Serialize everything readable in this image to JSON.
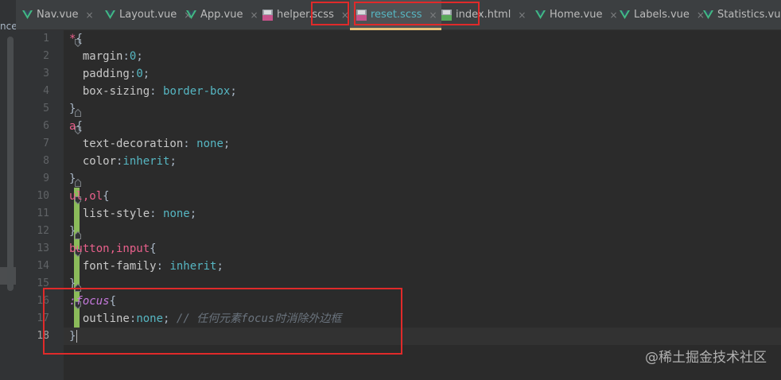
{
  "left_panel": {
    "fragment": "nce"
  },
  "tabs": [
    {
      "name": "nav-vue",
      "label": "Nav.vue",
      "icon": "vue-icon",
      "active": false
    },
    {
      "name": "layout-vue",
      "label": "Layout.vue",
      "icon": "vue-icon",
      "active": false
    },
    {
      "name": "app-vue",
      "label": "App.vue",
      "icon": "vue-icon",
      "active": false
    },
    {
      "name": "helper-scss",
      "label": "helper.scss",
      "icon": "sass-icon",
      "active": false
    },
    {
      "name": "reset-scss",
      "label": "reset.scss",
      "icon": "sass-icon",
      "active": true
    },
    {
      "name": "index-html",
      "label": "index.html",
      "icon": "html-icon",
      "active": false
    },
    {
      "name": "home-vue",
      "label": "Home.vue",
      "icon": "vue-icon",
      "active": false
    },
    {
      "name": "labels-vue",
      "label": "Labels.vue",
      "icon": "vue-icon",
      "active": false
    },
    {
      "name": "statistics-vue",
      "label": "Statistics.vue",
      "icon": "vue-icon",
      "active": false
    }
  ],
  "tab_close_glyph": "×",
  "colors": {
    "selector": "#e8608b",
    "value": "#6897bb",
    "keyword": "#56b6c2",
    "comment": "#6a737d",
    "pseudo": "#c679dd",
    "change_bar": "#8bbb5a",
    "highlight_box": "#e02a2a",
    "active_tab_underline": "#e5c07b"
  },
  "editor": {
    "current_line": 18,
    "lines": [
      {
        "n": "1",
        "selector": "*",
        "open": "{"
      },
      {
        "n": "2",
        "prop": "margin",
        "sep": ":",
        "value": "0",
        "end": ";"
      },
      {
        "n": "3",
        "prop": "padding",
        "sep": ":",
        "value": "0",
        "end": ";"
      },
      {
        "n": "4",
        "prop": "box-sizing",
        "sep": ": ",
        "value": "border-box",
        "end": ";"
      },
      {
        "n": "5",
        "close": "}"
      },
      {
        "n": "6",
        "selector": "a",
        "open": "{"
      },
      {
        "n": "7",
        "prop": "text-decoration",
        "sep": ": ",
        "value": "none",
        "end": ";"
      },
      {
        "n": "8",
        "prop": "color",
        "sep": ":",
        "value": "inherit",
        "end": ";"
      },
      {
        "n": "9",
        "close": "}"
      },
      {
        "n": "10",
        "selector": "ul,ol",
        "open": "{"
      },
      {
        "n": "11",
        "prop": "list-style",
        "sep": ": ",
        "value": "none",
        "end": ";"
      },
      {
        "n": "12",
        "close": "}"
      },
      {
        "n": "13",
        "selector": "button,input",
        "open": "{"
      },
      {
        "n": "14",
        "prop": "font-family",
        "sep": ": ",
        "value": "inherit",
        "end": ";"
      },
      {
        "n": "15",
        "close": "}"
      },
      {
        "n": "16",
        "pseudo": ":focus",
        "open": "{"
      },
      {
        "n": "17",
        "prop": "outline",
        "sep": ":",
        "value": "none",
        "end": ";",
        "comment": " // 任何元素focus时消除外边框"
      },
      {
        "n": "18",
        "close": "}"
      }
    ]
  },
  "watermark": "@稀土掘金技术社区"
}
